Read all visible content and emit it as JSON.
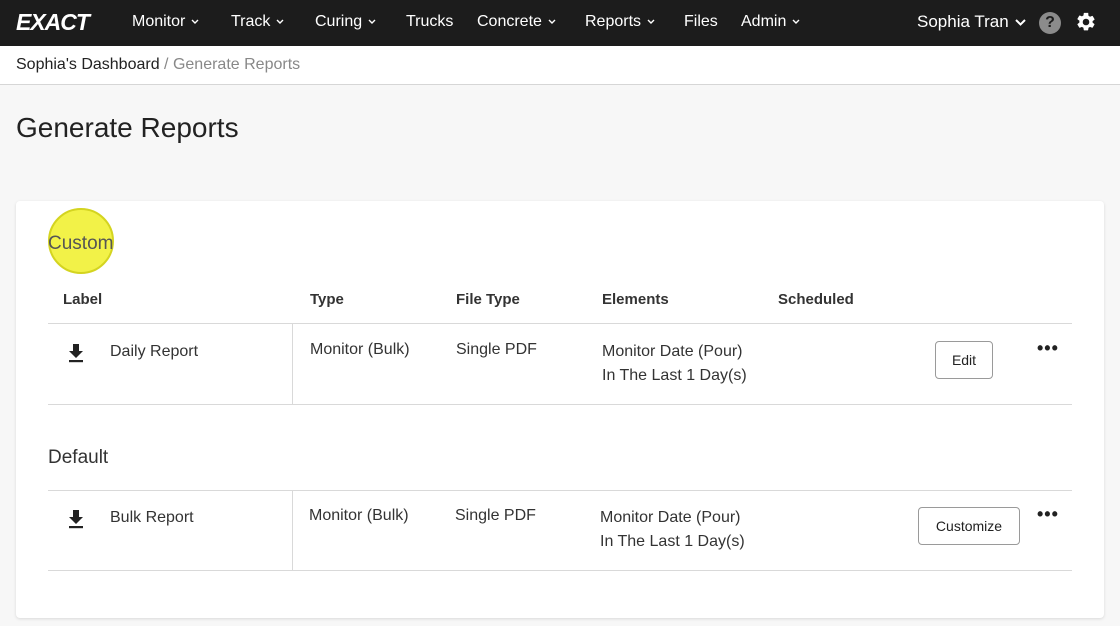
{
  "nav": {
    "logo": "EXACT",
    "items": [
      {
        "label": "Monitor",
        "dropdown": true
      },
      {
        "label": "Track",
        "dropdown": true
      },
      {
        "label": "Curing",
        "dropdown": true
      },
      {
        "label": "Trucks",
        "dropdown": false
      },
      {
        "label": "Concrete",
        "dropdown": true
      },
      {
        "label": "Reports",
        "dropdown": true
      },
      {
        "label": "Files",
        "dropdown": false
      },
      {
        "label": "Admin",
        "dropdown": true
      }
    ],
    "user": "Sophia Tran",
    "help_symbol": "?",
    "icons": [
      "help-icon",
      "gear-icon",
      "chevron-down-icon"
    ]
  },
  "breadcrumb": {
    "parent": "Sophia's Dashboard",
    "separator": "/",
    "current": "Generate Reports"
  },
  "page_title": "Generate Reports",
  "custom": {
    "title": "Custom",
    "headers": {
      "label": "Label",
      "type": "Type",
      "file_type": "File Type",
      "elements": "Elements",
      "scheduled": "Scheduled"
    },
    "row": {
      "label": "Daily Report",
      "type": "Monitor (Bulk)",
      "file_type": "Single PDF",
      "elements_line1": "Monitor Date (Pour)",
      "elements_line2": "In The Last 1 Day(s)",
      "scheduled": "",
      "action_label": "Edit",
      "more_label": "•••"
    }
  },
  "default": {
    "title": "Default",
    "row": {
      "label": "Bulk Report",
      "type": "Monitor (Bulk)",
      "file_type": "Single PDF",
      "elements_line1": "Monitor Date (Pour)",
      "elements_line2": "In The Last 1 Day(s)",
      "action_label": "Customize",
      "more_label": "•••"
    }
  },
  "colors": {
    "nav_bg": "#1c1c1c",
    "highlight": "#f0f028"
  }
}
